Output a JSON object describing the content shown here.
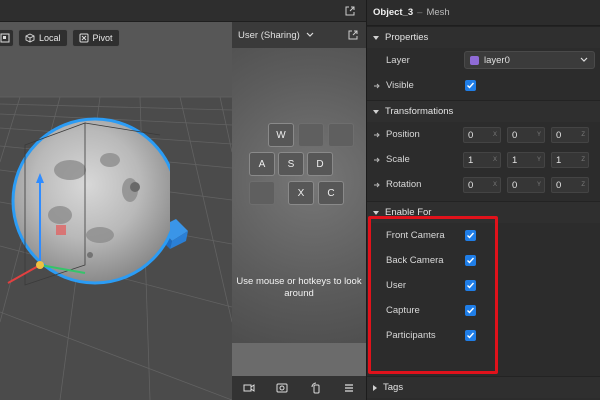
{
  "viewport": {
    "toolbar": {
      "local_label": "Local",
      "pivot_label": "Pivot"
    }
  },
  "preview": {
    "dropdown_label": "User (Sharing)",
    "keys": [
      "W",
      "A",
      "S",
      "D",
      "X",
      "C"
    ],
    "hint": "Use mouse or hotkeys to look around"
  },
  "inspector": {
    "object_name": "Object_3",
    "separator": "–",
    "object_type": "Mesh",
    "properties": {
      "title": "Properties",
      "layer_label": "Layer",
      "layer_value": "layer0",
      "layer_color": "#8f6bd6",
      "visible_label": "Visible",
      "visible_checked": true
    },
    "transformations": {
      "title": "Transformations",
      "position_label": "Position",
      "scale_label": "Scale",
      "rotation_label": "Rotation",
      "position": [
        "0",
        "0",
        "0"
      ],
      "scale": [
        "1",
        "1",
        "1"
      ],
      "rotation": [
        "0",
        "0",
        "0"
      ],
      "axes": [
        "X",
        "Y",
        "Z"
      ]
    },
    "enable_for": {
      "title": "Enable For",
      "items": [
        {
          "label": "Front Camera",
          "checked": true
        },
        {
          "label": "Back Camera",
          "checked": true
        },
        {
          "label": "User",
          "checked": true
        },
        {
          "label": "Capture",
          "checked": true
        },
        {
          "label": "Participants",
          "checked": true
        }
      ]
    },
    "tags": {
      "title": "Tags"
    }
  },
  "colors": {
    "accent": "#1f7ee8",
    "highlight": "#e0121b",
    "selection_outline": "#2b9cf5"
  }
}
